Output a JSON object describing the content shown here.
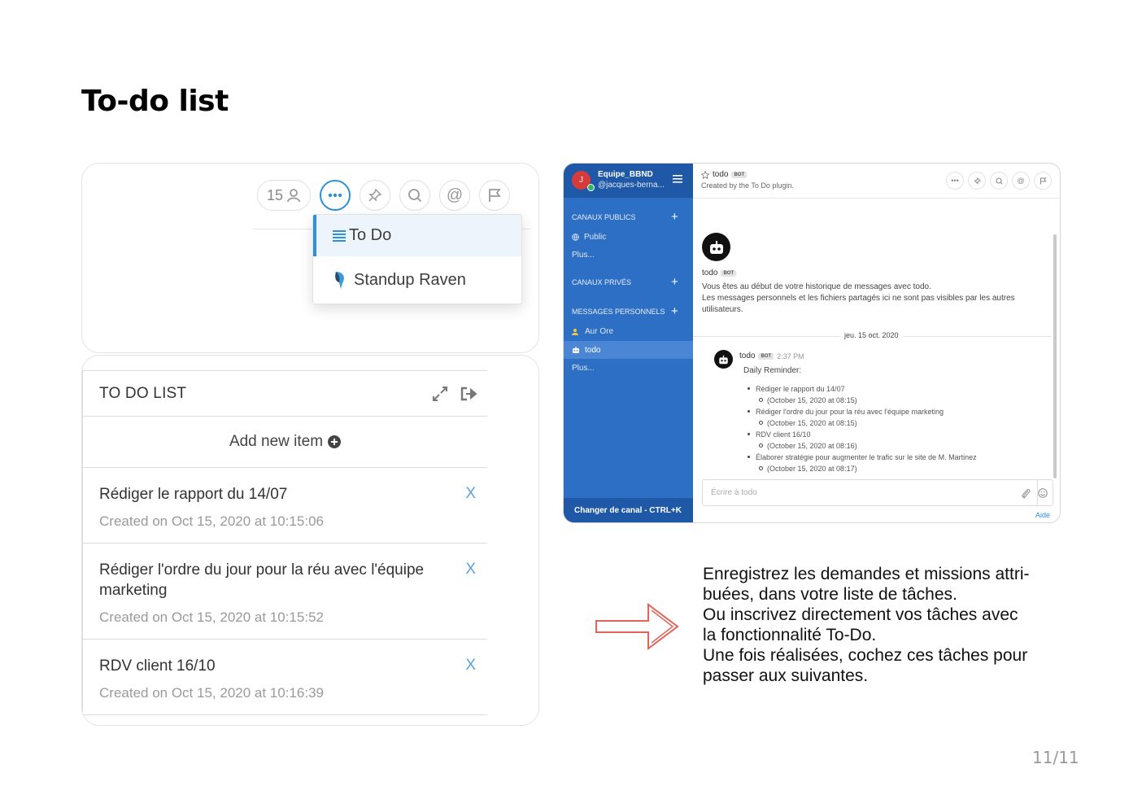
{
  "page": {
    "title": "To-do list",
    "pager": "11/11"
  },
  "toolbar": {
    "member_count": "15",
    "icons": [
      "member-icon",
      "more-icon",
      "pin-icon",
      "search-icon",
      "mention-icon",
      "flag-icon"
    ],
    "accent_color": "#2f8fd8"
  },
  "dropdown": {
    "items": [
      {
        "label": "To Do",
        "icon": "list-icon",
        "selected": true
      },
      {
        "label": "Standup Raven",
        "icon": "raven-icon",
        "selected": false
      }
    ]
  },
  "todo_panel": {
    "title": "TO DO LIST",
    "add_label": "Add new item",
    "remove_label": "X",
    "items": [
      {
        "title": "Rédiger le rapport du 14/07",
        "meta": "Created on Oct 15, 2020 at 10:15:06"
      },
      {
        "title": "Rédiger l'ordre du jour pour la réu avec l'équipe marketing",
        "meta": "Created on Oct 15, 2020 at 10:15:52"
      },
      {
        "title": "RDV client 16/10",
        "meta": "Created on Oct 15, 2020 at 10:16:39"
      }
    ]
  },
  "mattermost": {
    "sidebar_color": "#2d6fc4",
    "team_color": "#1e58a6",
    "team_initial": "J",
    "team_name": "Equipe_BBND",
    "username": "@jacques-berna...",
    "public_section": "CANAUX PUBLICS",
    "public_channel": "Public",
    "more_public": "Plus...",
    "private_section": "CANAUX PRIVÉS",
    "dm_section": "MESSAGES PERSONNELS",
    "dm_aur": "Aur Ore",
    "dm_todo": "todo",
    "more_dm": "Plus...",
    "switch_channel": "Changer de canal - CTRL+K",
    "channel_name": "todo",
    "bot_badge": "BOT",
    "channel_purpose": "Created by the To Do plugin.",
    "intro_name": "todo",
    "intro_line1": "Vous êtes au début de votre historique de messages avec todo.",
    "intro_line2": "Les messages personnels et les fichiers partagés ici ne sont pas visibles par les autres utilisateurs.",
    "date_separator": "jeu. 15 oct. 2020",
    "post_author": "todo",
    "post_time": "2:37 PM",
    "post_text": "Daily Reminder:",
    "reminders": [
      {
        "task": "Rédiger le rapport du 14/07",
        "when": "(October 15, 2020 at 08:15)"
      },
      {
        "task": "Rédiger l'ordre du jour pour la réu avec l'équipe marketing",
        "when": "(October 15, 2020 at 08:15)"
      },
      {
        "task": "RDV client 16/10",
        "when": "(October 15, 2020 at 08:16)"
      },
      {
        "task": "Élaborer stratégie pour augmenter le trafic sur le site de M. Martinez",
        "when": "(October 15, 2020 at 08:17)"
      }
    ],
    "input_placeholder": "Écrire à todo",
    "help_link": "Aide"
  },
  "description": {
    "line1": "Enregistrez les demandes et missions attri-",
    "line2": "buées, dans votre liste de tâches.",
    "line3": "Ou inscrivez directement vos tâches avec",
    "line4": "la fonctionnalité To-Do.",
    "line5": "Une fois réalisées, cochez ces tâches pour",
    "line6": "passer aux suivantes.",
    "arrow_color": "#e0645a"
  }
}
